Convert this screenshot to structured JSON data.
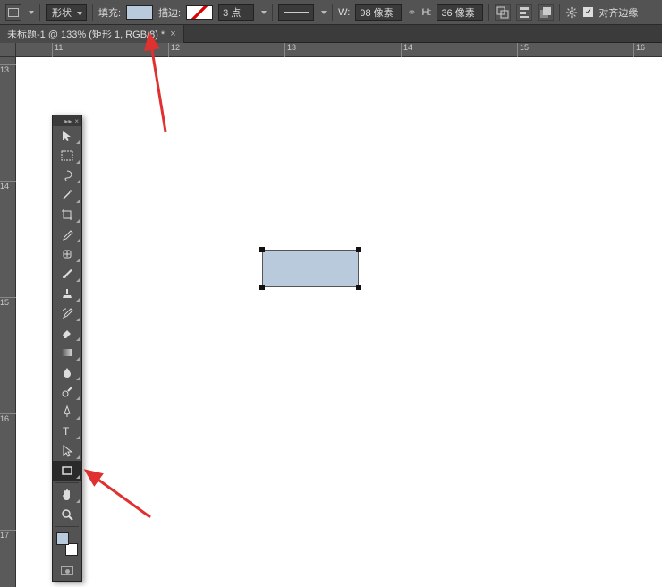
{
  "optionsBar": {
    "modeLabel": "形状",
    "fillLabel": "填充:",
    "strokeLabel": "描边:",
    "strokeWidth": "3 点",
    "wLabel": "W:",
    "wValue": "98 像素",
    "hLabel": "H:",
    "hValue": "36 像素",
    "alignEdgesLabel": "对齐边缘"
  },
  "tab": {
    "title": "未标题-1 @ 133% (矩形 1, RGB/8) *"
  },
  "rulerH": [
    "11",
    "12",
    "13",
    "14",
    "15",
    "16"
  ],
  "rulerV": [
    "13",
    "14",
    "15",
    "16",
    "17"
  ],
  "colors": {
    "fill": "#b9cadd"
  }
}
